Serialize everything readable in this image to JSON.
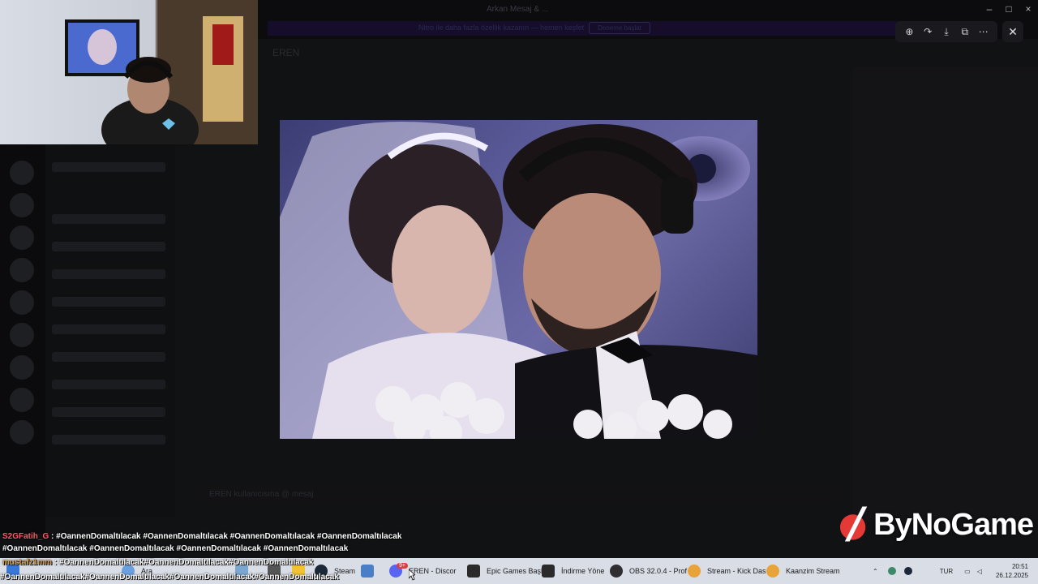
{
  "viewer": {
    "window_title": "Arkan Mesaj & ...",
    "banner_text": "Nitro ile daha fazla özellik kazanın — hemen keşfet",
    "banner_button": "Deneme başlat",
    "dm_title": "EREN",
    "composer_placeholder": "EREN kullanıcısına @ mesaj",
    "toolbar_icons": [
      "zoom-in-icon",
      "share-icon",
      "download-icon",
      "open-external-icon",
      "more-icon"
    ],
    "close_icon": "close-icon"
  },
  "chat_overlay": [
    {
      "user": "S2GFatih_G",
      "text": " : #OannenDomaltılacak #OannenDomaltılacak #OannenDomaltılacak #OannenDomaltılacak"
    },
    {
      "user": "",
      "text": "#OannenDomaltılacak #OannenDomaltılacak #OannenDomaltılacak #OannenDomaltılacak"
    },
    {
      "user": "mustafz1mm",
      "text": " : #OannenDomaltılacak#OannenDomaltılacak#OannenDomaltılacak"
    },
    {
      "user": "",
      "text": "#OannenDomaltılacak#OannenDomaltılacak#OannenDomaltılacak#OannenDomaltılacak"
    }
  ],
  "brand": {
    "name": "ByNoGame"
  },
  "taskbar": {
    "search_label": "Ara",
    "items": [
      {
        "label": "Steam",
        "icon": "steam-icon",
        "color": "#1b2838"
      },
      {
        "label": "",
        "icon": "settings-icon",
        "color": "#4a7fc8"
      },
      {
        "label": "EREN - Discor",
        "icon": "discord-icon",
        "color": "#5865f2",
        "badge": "9+"
      },
      {
        "label": "Epic Games Başl",
        "icon": "epic-games-icon",
        "color": "#2a2a2a"
      },
      {
        "label": "İndirme Yöne",
        "icon": "epic-games-icon",
        "color": "#2a2a2a"
      },
      {
        "label": "OBS 32.0.4 - Prof",
        "icon": "obs-icon",
        "color": "#302e31"
      },
      {
        "label": "Stream - Kick Das",
        "icon": "chrome-icon",
        "color": "#e8a33a"
      },
      {
        "label": "Kaanzim Stream",
        "icon": "chrome-icon",
        "color": "#e8a33a"
      }
    ],
    "tray_lang": "TUR",
    "time": "20:51",
    "date": "26.12.2025"
  }
}
